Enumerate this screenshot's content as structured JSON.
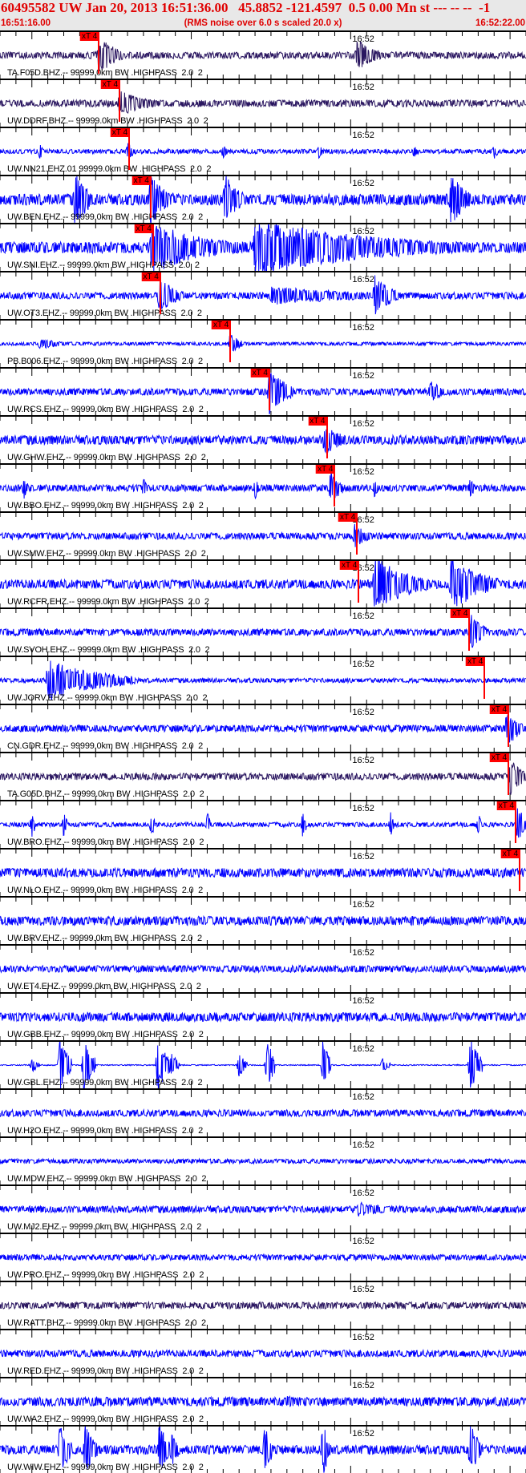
{
  "header": {
    "title": "60495582 UW Jan 20, 2013 16:51:36.00   45.8852 -121.4597  0.5 0.00 Mn st --- -- --  -1",
    "start_time": "16:51:16.00",
    "subtitle": "(RMS noise over 6.0 s scaled 20.0 x)",
    "end_time": "16:52:22.00"
  },
  "time_axis": {
    "duration_s": 66,
    "major_label": "16:52",
    "major_label_time_s": 44,
    "major_tick_every_s": 20,
    "major_tick_offset_s": 4,
    "minor_tick_every_s": 2
  },
  "colors": {
    "bhz": "#2a1660",
    "ehz": "#0000ff",
    "pick": "#ff0000"
  },
  "pick_label": "xT 4",
  "traces": [
    {
      "label": "TA.F05D.BHZ.-- 99999.0km BW .HIGHPASS  2.0  2",
      "type": "bhz",
      "noise": 3,
      "pick_s": 12.4,
      "bursts": [
        [
          12.4,
          22,
          3
        ],
        [
          44.8,
          18,
          3
        ]
      ]
    },
    {
      "label": "UW.DDRF.BHZ.-- 99999.0km BW .HIGHPASS  2.0  2",
      "type": "bhz",
      "noise": 3,
      "pick_s": 15,
      "bursts": [
        [
          15,
          14,
          5
        ]
      ]
    },
    {
      "label": "UW.NN21.EHZ.01 99999.0km BW .HIGHPASS  2.0  2",
      "type": "ehz",
      "noise": 2,
      "pick_s": 16.2,
      "bursts": [
        [
          5,
          8,
          0.5
        ],
        [
          16,
          10,
          1
        ],
        [
          28,
          8,
          0.5
        ],
        [
          40,
          8,
          0.5
        ],
        [
          52,
          8,
          0.5
        ],
        [
          62,
          8,
          0.5
        ]
      ]
    },
    {
      "label": "UW.BEN.EHZ.-- 99999.0km BW .HIGHPASS  2.0  2",
      "type": "ehz",
      "noise": 5,
      "pick_s": 18.9,
      "bursts": [
        [
          9.4,
          30,
          2.4
        ],
        [
          18.9,
          30,
          3
        ],
        [
          28.2,
          30,
          2.4
        ],
        [
          56.6,
          30,
          2.4
        ]
      ]
    },
    {
      "label": "UW.SNI.EHZ.-- 99999.0km BW .HIGHPASS  2.0  2",
      "type": "ehz",
      "noise": 5,
      "pick_s": 19.2,
      "bursts": [
        [
          19,
          28,
          11
        ],
        [
          32,
          30,
          26
        ]
      ]
    },
    {
      "label": "UW.OT3.EHZ.-- 99999.0km BW .HIGHPASS  2.0  2",
      "type": "ehz",
      "noise": 3,
      "pick_s": 20.1,
      "bursts": [
        [
          20,
          20,
          3
        ],
        [
          34,
          10,
          20
        ],
        [
          47,
          22,
          3
        ]
      ]
    },
    {
      "label": "PB.B006.EHZ.-- 99999.0km BW .HIGHPASS  2.0  2",
      "type": "ehz",
      "noise": 1.5,
      "pick_s": 28.9,
      "bursts": [
        [
          5,
          6,
          4
        ],
        [
          28.9,
          12,
          1.5
        ]
      ]
    },
    {
      "label": "UW.RCS.EHZ.-- 99999.0km BW .HIGHPASS  2.0  2",
      "type": "ehz",
      "noise": 3,
      "pick_s": 33.8,
      "bursts": [
        [
          33.8,
          26,
          3
        ],
        [
          54,
          14,
          2
        ]
      ]
    },
    {
      "label": "UW.GHW.EHZ.-- 99999.0km BW .HIGHPASS  2.0  2",
      "type": "ehz",
      "noise": 4,
      "pick_s": 41,
      "bursts": [
        [
          40.7,
          18,
          3
        ]
      ]
    },
    {
      "label": "UW.BBO.EHZ.-- 99999.0km BW .HIGHPASS  2.0  2",
      "type": "ehz",
      "noise": 3,
      "pick_s": 42,
      "bursts": [
        [
          3,
          12,
          0.5
        ],
        [
          18,
          12,
          0.5
        ],
        [
          32,
          12,
          0.5
        ],
        [
          41.5,
          20,
          1.5
        ],
        [
          47,
          12,
          0.5
        ],
        [
          59,
          12,
          0.5
        ]
      ]
    },
    {
      "label": "UW.SMW.EHZ.-- 99999.0km BW .HIGHPASS  2.0  2",
      "type": "ehz",
      "noise": 3,
      "pick_s": 44.8,
      "bursts": [
        [
          44.5,
          14,
          2
        ]
      ]
    },
    {
      "label": "UW.RCFR.EHZ.-- 99999.0km BW .HIGHPASS  2.0  2",
      "type": "ehz",
      "noise": 4,
      "pick_s": 45,
      "bursts": [
        [
          47,
          30,
          7
        ],
        [
          56.6,
          30,
          6
        ]
      ]
    },
    {
      "label": "UW.SVOH.EHZ.-- 99999.0km BW .HIGHPASS  2.0  2",
      "type": "ehz",
      "noise": 3,
      "pick_s": 58.9,
      "bursts": [
        [
          59,
          22,
          2
        ]
      ]
    },
    {
      "label": "UW.JORV.EHZ.-- 99999.0km BW .HIGHPASS  2.0  2",
      "type": "ehz",
      "noise": 2,
      "pick_s": 60.8,
      "bursts": [
        [
          6,
          22,
          11
        ]
      ]
    },
    {
      "label": "CN.GDR.EHZ.-- 99999.0km BW .HIGHPASS  2.0  2",
      "type": "ehz",
      "noise": 3,
      "pick_s": 63.8,
      "bursts": [
        [
          63.6,
          22,
          2
        ]
      ]
    },
    {
      "label": "TA.G05D.BHZ.-- 99999.0km BW .HIGHPASS  2.0  2",
      "type": "bhz",
      "noise": 3,
      "pick_s": 63.8,
      "bursts": [
        [
          64,
          22,
          2
        ]
      ]
    },
    {
      "label": "UW.BRO.EHZ.-- 99999.0km BW .HIGHPASS  2.0  2",
      "type": "ehz",
      "noise": 2,
      "pick_s": 64.7,
      "bursts": [
        [
          4,
          14,
          0.4
        ],
        [
          8,
          14,
          0.4
        ],
        [
          19,
          14,
          0.4
        ],
        [
          26,
          14,
          0.4
        ],
        [
          38,
          14,
          0.4
        ],
        [
          49,
          14,
          0.4
        ],
        [
          60,
          14,
          0.4
        ],
        [
          65,
          22,
          1
        ]
      ]
    },
    {
      "label": "UW.NLO.EHZ.-- 99999.0km BW .HIGHPASS  2.0  2",
      "type": "ehz",
      "noise": 4,
      "pick_s": 65.2,
      "bursts": []
    },
    {
      "label": "UW.BRV.EHZ.-- 99999.0km BW .HIGHPASS  2.0  2",
      "type": "ehz",
      "noise": 4,
      "bursts": []
    },
    {
      "label": "UW.ET4.EHZ.-- 99999.0km BW .HIGHPASS  2.0  2",
      "type": "ehz",
      "noise": 3,
      "bursts": []
    },
    {
      "label": "UW.GBB.EHZ.-- 99999.0km BW .HIGHPASS  2.0  2",
      "type": "ehz",
      "noise": 4,
      "bursts": []
    },
    {
      "label": "UW.GBL.EHZ.-- 99999.0km BW .HIGHPASS  2.0  2",
      "type": "ehz",
      "noise": 0.5,
      "bursts": [
        [
          4,
          8,
          1
        ],
        [
          7.5,
          30,
          1.5
        ],
        [
          10.5,
          30,
          1.5
        ],
        [
          19.8,
          30,
          1.5
        ],
        [
          21.5,
          14,
          1
        ],
        [
          30,
          14,
          1
        ],
        [
          33.5,
          30,
          1
        ],
        [
          40.5,
          30,
          1
        ],
        [
          48,
          8,
          1
        ],
        [
          59,
          30,
          1.5
        ]
      ]
    },
    {
      "label": "UW.H2O.EHZ.-- 99999.0km BW .HIGHPASS  2.0  2",
      "type": "ehz",
      "noise": 3,
      "bursts": []
    },
    {
      "label": "UW.MDW.EHZ.-- 99999.0km BW .HIGHPASS  2.0  2",
      "type": "ehz",
      "noise": 2,
      "bursts": []
    },
    {
      "label": "UW.MJ2.EHZ.-- 99999.0km BW .HIGHPASS  2.0  2",
      "type": "ehz",
      "noise": 3,
      "bursts": [
        [
          45,
          8,
          6
        ]
      ]
    },
    {
      "label": "UW.PRO.EHZ.-- 99999.0km BW .HIGHPASS  2.0  2",
      "type": "ehz",
      "noise": 2.5,
      "bursts": []
    },
    {
      "label": "UW.RATT.BHZ.-- 99999.0km BW .HIGHPASS  2.0  2",
      "type": "bhz",
      "noise": 3,
      "bursts": []
    },
    {
      "label": "UW.RED.EHZ.-- 99999.0km BW .HIGHPASS  2.0  2",
      "type": "ehz",
      "noise": 3,
      "bursts": []
    },
    {
      "label": "UW.WA2.EHZ.-- 99999.0km BW .HIGHPASS  2.0  2",
      "type": "ehz",
      "noise": 4,
      "bursts": [
        [
          36,
          6,
          8
        ]
      ]
    },
    {
      "label": "UW.WIW.EHZ.-- 99999.0km BW .HIGHPASS  2.0  2",
      "type": "ehz",
      "noise": 4,
      "bursts": [
        [
          7.5,
          30,
          1.5
        ],
        [
          10.7,
          30,
          1.5
        ],
        [
          20,
          30,
          1.5
        ],
        [
          21.5,
          22,
          1
        ],
        [
          33.2,
          30,
          1
        ],
        [
          40.5,
          30,
          1
        ],
        [
          59,
          30,
          1.5
        ]
      ]
    }
  ]
}
